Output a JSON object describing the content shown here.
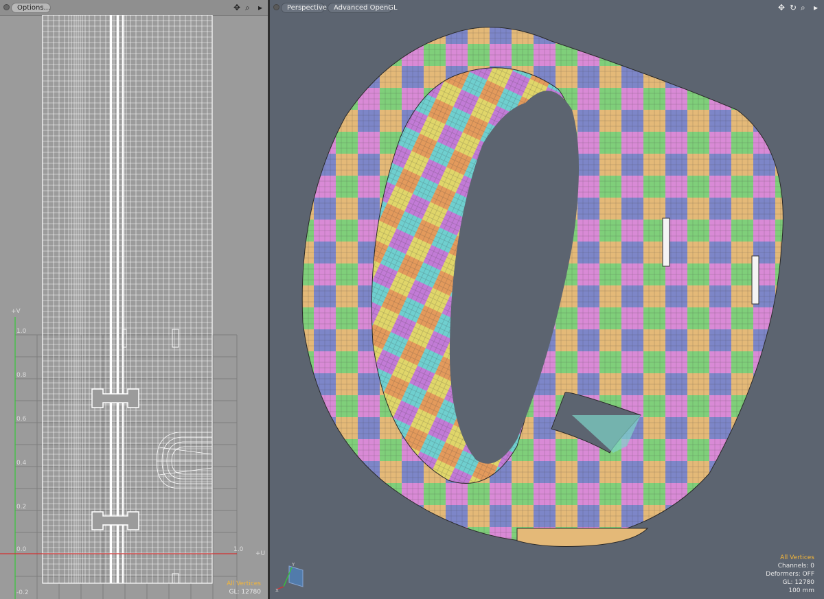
{
  "uv_panel": {
    "options_label": "Options...",
    "axis_v_label": "+V",
    "axis_u_label": "+U",
    "v_ticks": [
      "1.0",
      "0.8",
      "0.6",
      "0.4",
      "0.2",
      "0.0",
      "-0.2"
    ],
    "u_tick_right": "1.0",
    "status_mode": "All Vertices",
    "status_gl": "GL: 12780"
  },
  "viewport": {
    "view_mode": "Perspective",
    "render_mode": "Advanced OpenGL",
    "status_mode": "All Vertices",
    "status_channels": "Channels: 0",
    "status_deformers": "Deformers: OFF",
    "status_gl": "GL: 12780",
    "status_scale": "100 mm"
  },
  "icons": {
    "left_header": [
      "move-icon",
      "zoom-icon",
      "expand-arrow-icon"
    ],
    "right_header": [
      "move-icon",
      "rotate-icon",
      "zoom-icon",
      "expand-arrow-icon"
    ]
  },
  "colors": {
    "accent_orange": "#f2b53a",
    "viewport_bg": "#5c6470",
    "uv_bg": "#9b9b9b",
    "v_axis_green": "#35c83a",
    "u_axis_red": "#d23030"
  }
}
